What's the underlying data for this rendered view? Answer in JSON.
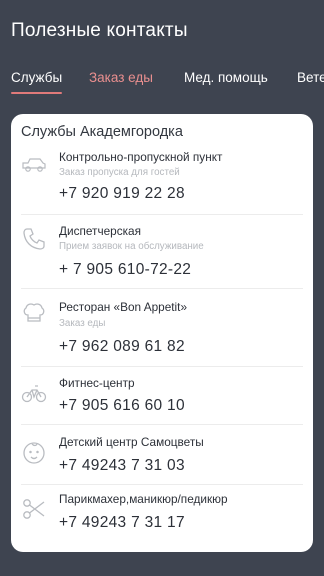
{
  "header": {
    "title": "Полезные контакты"
  },
  "tabs": [
    {
      "label": "Службы"
    },
    {
      "label": "Заказ еды"
    },
    {
      "label": "Мед. помощь"
    },
    {
      "label": "Вете"
    }
  ],
  "card": {
    "title": "Службы Академгородка",
    "items": [
      {
        "icon": "car-icon",
        "name": "Контрольно-пропускной пункт",
        "sub": "Заказ пропуска для гостей",
        "phone": "+7 920 919 22 28"
      },
      {
        "icon": "phone-icon",
        "name": "Диспетчерская",
        "sub": "Прием заявок на обслуживание",
        "phone": "+ 7 905 610-72-22"
      },
      {
        "icon": "chef-hat-icon",
        "name": "Ресторан «Bon Appetit»",
        "sub": "Заказ еды",
        "phone": "+7 962 089 61 82"
      },
      {
        "icon": "bicycle-icon",
        "name": "Фитнес-центр",
        "sub": "",
        "phone": "+7 905 616 60 10"
      },
      {
        "icon": "baby-icon",
        "name": "Детский центр Самоцветы",
        "sub": "",
        "phone": "+7 49243 7 31 03"
      },
      {
        "icon": "scissors-icon",
        "name": "Парикмахер,маникюр/педикюр",
        "sub": "",
        "phone": "+7 49243 7 31 17"
      }
    ]
  },
  "colors": {
    "background": "#3e4450",
    "accent": "#e07a7a",
    "card": "#ffffff"
  }
}
